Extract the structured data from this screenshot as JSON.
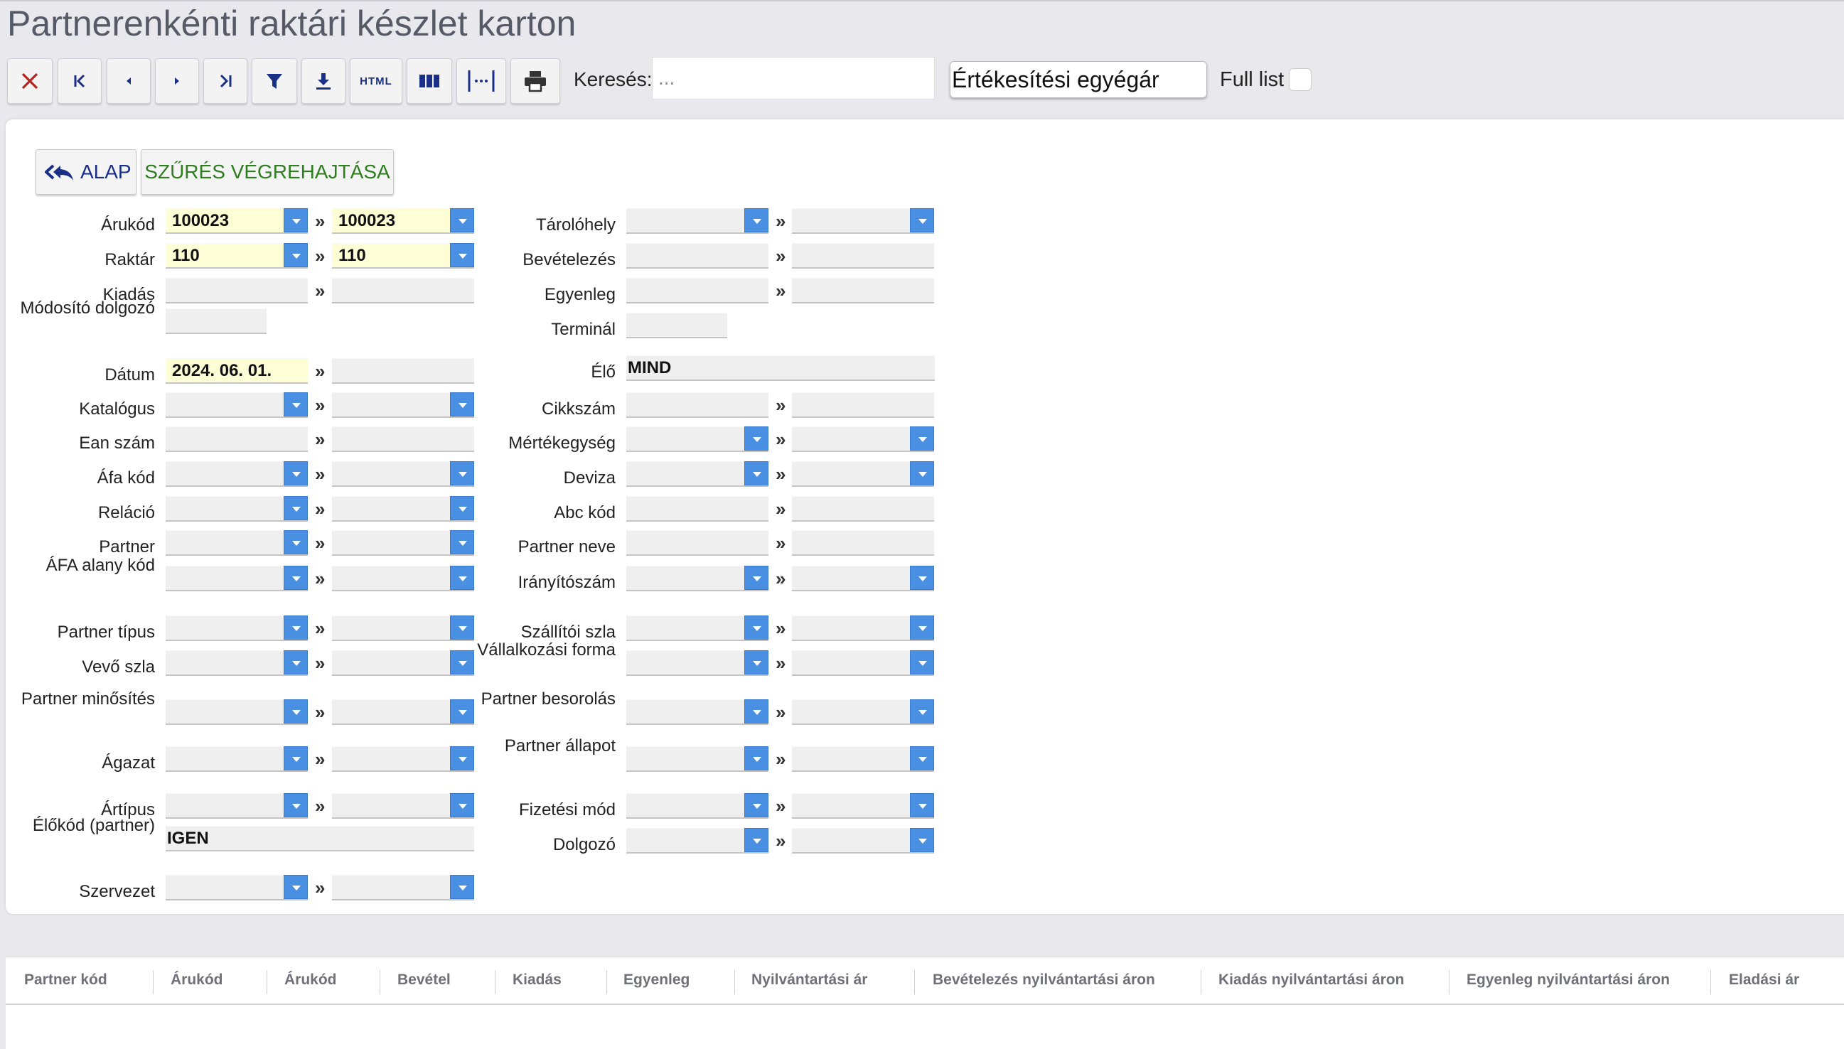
{
  "page": {
    "title": "Partnerenkénti raktári készlet karton"
  },
  "toolbar": {
    "buttons": [
      {
        "name": "close-button",
        "icon": "close-icon"
      },
      {
        "name": "first-button",
        "icon": "first-page-icon"
      },
      {
        "name": "prev-button",
        "icon": "previous-icon"
      },
      {
        "name": "next-button",
        "icon": "next-icon"
      },
      {
        "name": "last-button",
        "icon": "last-page-icon"
      },
      {
        "name": "filter-button",
        "icon": "filter-icon"
      },
      {
        "name": "download-button",
        "icon": "download-icon"
      },
      {
        "name": "html-button",
        "icon": "html-icon",
        "text": "HTML"
      },
      {
        "name": "columns-button",
        "icon": "columns-icon"
      },
      {
        "name": "column-width-button",
        "icon": "column-width-icon"
      },
      {
        "name": "print-button",
        "icon": "print-icon"
      }
    ],
    "search_label": "Keresés:",
    "search_placeholder": "...",
    "price_button_label": "Értékesítési egyégár",
    "full_list_label": "Full list",
    "full_list_checked": false
  },
  "filter": {
    "alap_label": "ALAP",
    "execute_label": "SZŰRÉS VÉGREHAJTÁSA",
    "separator": "»",
    "left": [
      {
        "label": "Árukód",
        "from": "100023",
        "to": "100023",
        "yellow": true,
        "dropdown": true
      },
      {
        "label": "Raktár",
        "from": "110",
        "to": "110",
        "yellow": true,
        "dropdown": true
      },
      {
        "label": "Kiadás",
        "from": "",
        "to": "",
        "dropdown": false
      },
      {
        "label": "Módosító dolgozó",
        "from": ""
      },
      {
        "label": "Dátum",
        "from": "2024. 06. 01.",
        "to": "",
        "yellow_from": true
      },
      {
        "label": "Katalógus",
        "from": "",
        "to": "",
        "dropdown": true
      },
      {
        "label": "Ean szám",
        "from": "",
        "to": ""
      },
      {
        "label": "Áfa kód",
        "from": "",
        "to": "",
        "dropdown": true
      },
      {
        "label": "Reláció",
        "from": "",
        "to": "",
        "dropdown": true
      },
      {
        "label": "Partner",
        "from": "",
        "to": "",
        "dropdown": true
      },
      {
        "label": "ÁFA alany kód",
        "from": "",
        "to": "",
        "dropdown": true
      },
      {
        "label": "Partner típus",
        "from": "",
        "to": "",
        "dropdown": true
      },
      {
        "label": "Vevő szla",
        "from": "",
        "to": "",
        "dropdown": true
      },
      {
        "label": "Partner minősítés",
        "from": "",
        "to": "",
        "dropdown": true
      },
      {
        "label": "Ágazat",
        "from": "",
        "to": "",
        "dropdown": true
      },
      {
        "label": "Ártípus",
        "from": "",
        "to": "",
        "dropdown": true
      },
      {
        "label": "Élőkód (partner)",
        "value": "IGEN"
      },
      {
        "label": "Szervezet",
        "from": "",
        "to": "",
        "dropdown": true
      }
    ],
    "right": [
      {
        "label": "Tárolóhely",
        "from": "",
        "to": "",
        "dropdown": true
      },
      {
        "label": "Bevételezés",
        "from": "",
        "to": ""
      },
      {
        "label": "Egyenleg",
        "from": "",
        "to": ""
      },
      {
        "label": "Terminál",
        "from": ""
      },
      {
        "label": "Élő",
        "value": "MIND"
      },
      {
        "label": "Cikkszám",
        "from": "",
        "to": ""
      },
      {
        "label": "Mértékegység",
        "from": "",
        "to": "",
        "dropdown": true
      },
      {
        "label": "Deviza",
        "from": "",
        "to": "",
        "dropdown": true
      },
      {
        "label": "Abc kód",
        "from": "",
        "to": ""
      },
      {
        "label": "Partner neve",
        "from": "",
        "to": ""
      },
      {
        "label": "Irányítószám",
        "from": "",
        "to": "",
        "dropdown": true
      },
      {
        "label": "Szállítói szla",
        "from": "",
        "to": "",
        "dropdown": true
      },
      {
        "label": "Vállalkozási forma",
        "from": "",
        "to": "",
        "dropdown": true
      },
      {
        "label": "Partner besorolás",
        "from": "",
        "to": "",
        "dropdown": true
      },
      {
        "label": "Partner állapot",
        "from": "",
        "to": "",
        "dropdown": true
      },
      {
        "label": "Fizetési mód",
        "from": "",
        "to": "",
        "dropdown": true
      },
      {
        "label": "Dolgozó",
        "from": "",
        "to": "",
        "dropdown": true
      }
    ]
  },
  "grid": {
    "columns": [
      "Partner kód",
      "Árukód",
      "Árukód",
      "Bevétel",
      "Kiadás",
      "Egyenleg",
      "Nyilvántartási ár",
      "Bevételezés nyilvántartási áron",
      "Kiadás nyilvántartási áron",
      "Egyenleg nyilvántartási áron",
      "Eladási ár"
    ]
  },
  "colors": {
    "accent_blue": "#4a90e2",
    "alap_blue": "#1a2f86",
    "exec_green": "#2e7d1f",
    "highlight_yellow": "#fdfdd6",
    "close_red": "#b3261e"
  }
}
